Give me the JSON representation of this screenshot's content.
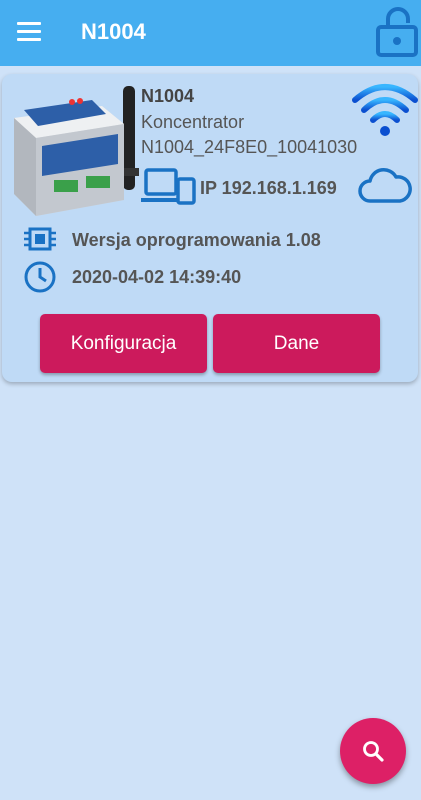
{
  "appbar": {
    "title": "N1004"
  },
  "device": {
    "name": "N1004",
    "type": "Koncentrator",
    "id": "N1004_24F8E0_10041030",
    "ip": "IP 192.168.1.169",
    "firmware": "Wersja oprogramowania  1.08",
    "datetime": "2020-04-02 14:39:40"
  },
  "buttons": {
    "config": "Konfiguracja",
    "data": "Dane"
  },
  "colors": {
    "appbar": "#46aef0",
    "background": "#cfe2f8",
    "card": "#bfdaf6",
    "icon_blue": "#1a72c4",
    "button": "#cc1a5c",
    "fab": "#dd2066"
  },
  "icons": {
    "menu": "menu-icon",
    "lock": "lock-open-icon",
    "wifi": "wifi-icon",
    "devices": "devices-icon",
    "cloud": "cloud-icon",
    "chip": "chip-icon",
    "clock": "clock-icon",
    "search": "search-icon"
  }
}
